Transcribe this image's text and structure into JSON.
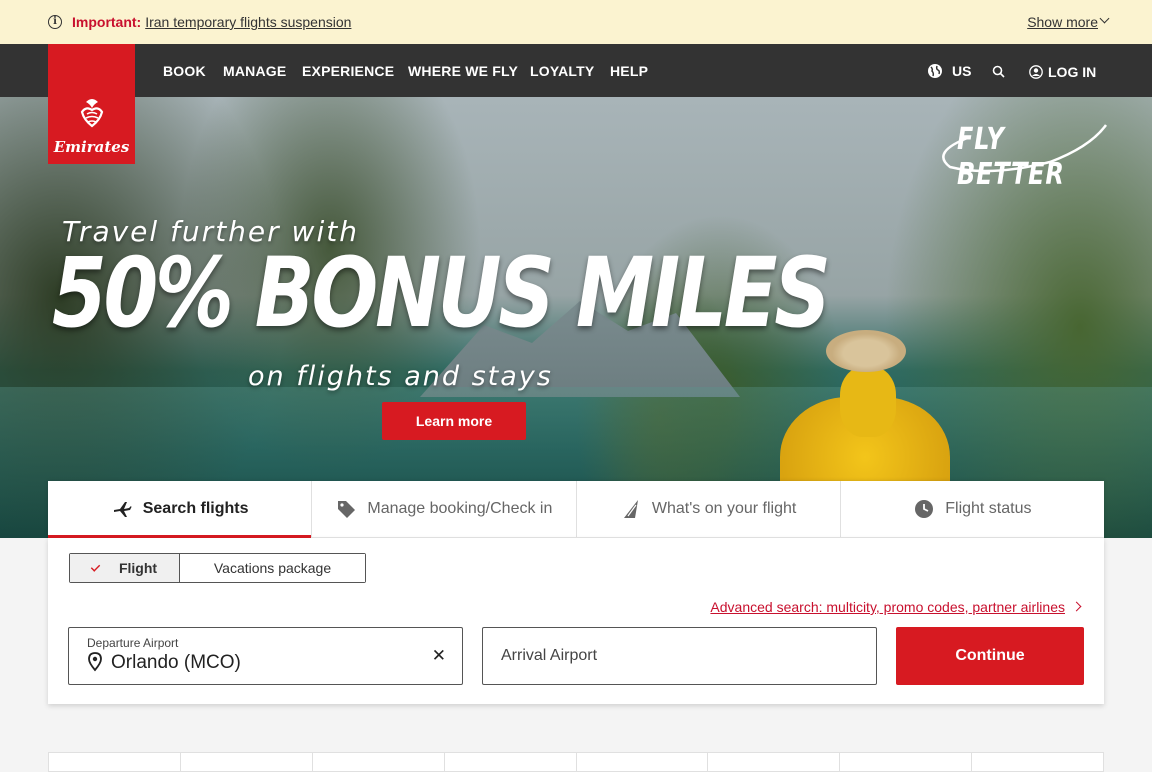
{
  "alert": {
    "important_label": "Important:",
    "link_text": "Iran temporary flights suspension",
    "show_more": "Show more"
  },
  "brand": {
    "logo_text": "Emirates",
    "accent_color": "#d71a21"
  },
  "nav": {
    "items": [
      {
        "label": "BOOK"
      },
      {
        "label": "MANAGE"
      },
      {
        "label": "EXPERIENCE"
      },
      {
        "label": "WHERE WE FLY"
      },
      {
        "label": "LOYALTY"
      },
      {
        "label": "HELP"
      }
    ],
    "region": "US",
    "login": "LOG IN"
  },
  "hero": {
    "tagline": "FLY BETTER",
    "pretitle": "Travel further with",
    "title": "50% BONUS MILES",
    "subtitle": "on flights and stays",
    "cta": "Learn more"
  },
  "tabs": [
    {
      "label": "Search flights",
      "icon": "plane-icon",
      "active": true
    },
    {
      "label": "Manage booking/Check in",
      "icon": "tag-icon",
      "active": false
    },
    {
      "label": "What's on your flight",
      "icon": "tailfin-icon",
      "active": false
    },
    {
      "label": "Flight status",
      "icon": "clock-icon",
      "active": false
    }
  ],
  "search": {
    "trip_types": [
      {
        "label": "Flight",
        "selected": true
      },
      {
        "label": "Vacations package",
        "selected": false
      }
    ],
    "advanced_link": "Advanced search: multicity, promo codes, partner airlines",
    "departure": {
      "label": "Departure Airport",
      "value": "Orlando (MCO)"
    },
    "arrival": {
      "placeholder": "Arrival Airport"
    },
    "continue": "Continue"
  }
}
